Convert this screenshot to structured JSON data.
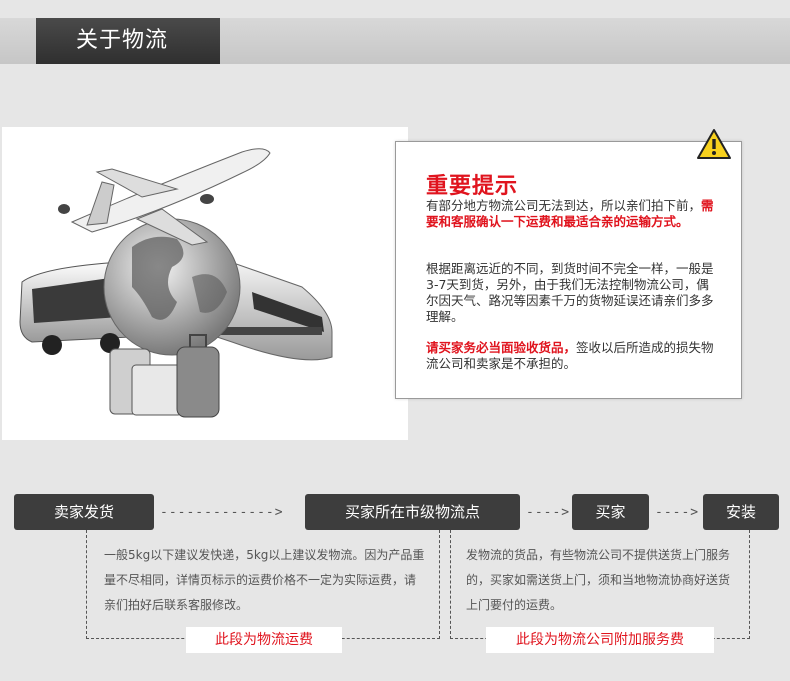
{
  "header": {
    "title": "关于物流"
  },
  "notice": {
    "title": "重要提示",
    "p1_normal": "有部分地方物流公司无法到达，所以亲们拍下前，",
    "p1_red": "需要和客服确认一下运费和最适合亲的运输方式。",
    "p2": "根据距离远近的不同，到货时间不完全一样，一般是3-7天到货，另外，由于我们无法控制物流公司，偶尔因天气、路况等因素千万的货物延误还请亲们多多理解。",
    "p3_red": "请买家务必当面验收货品，",
    "p3_normal": "签收以后所造成的损失物流公司和卖家是不承担的。"
  },
  "flow": {
    "steps": [
      "卖家发货",
      "买家所在市级物流点",
      "买家",
      "安装"
    ],
    "arrows": [
      "------------->",
      "---->",
      "---->"
    ]
  },
  "notes": {
    "left": "一般5kg以下建议发快递，5kg以上建议发物流。因为产品重量不尽相同，详情页标示的运费价格不一定为实际运费，请亲们拍好后联系客服修改。",
    "right": "发物流的货品，有些物流公司不提供送货上门服务的，买家如需送货上门，须和当地物流协商好送货上门要付的运费。",
    "left_tag": "此段为物流运费",
    "right_tag": "此段为物流公司附加服务费"
  },
  "icons": [
    "warning-icon",
    "airplane-icon",
    "globe-icon",
    "bus-icon",
    "train-icon",
    "luggage-icon"
  ]
}
